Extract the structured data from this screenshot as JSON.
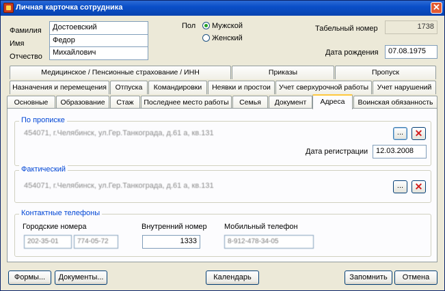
{
  "window": {
    "title": "Личная карточка сотрудника",
    "close_glyph": "✕"
  },
  "personal": {
    "surname_label": "Фамилия",
    "surname": "Достоевский",
    "name_label": "Имя",
    "name": "Федор",
    "patronymic_label": "Отчество",
    "patronymic": "Михайлович",
    "gender_label": "Пол",
    "male": "Мужской",
    "female": "Женский",
    "gender_selected": "male",
    "tab_number_label": "Табельный номер",
    "tab_number": "1738",
    "birth_label": "Дата рождения",
    "birth": "07.08.1975"
  },
  "tabs_row1": [
    {
      "label": "Медицинское / Пенсионные страхование / ИНН"
    },
    {
      "label": "Приказы"
    },
    {
      "label": "Пропуск"
    }
  ],
  "tabs_row2": [
    {
      "label": "Назначения и перемещения"
    },
    {
      "label": "Отпуска"
    },
    {
      "label": "Командировки"
    },
    {
      "label": "Неявки и простои"
    },
    {
      "label": "Учет сверхурочной работы"
    },
    {
      "label": "Учет нарушений"
    }
  ],
  "tabs_row3": [
    {
      "label": "Основные"
    },
    {
      "label": "Образование"
    },
    {
      "label": "Стаж"
    },
    {
      "label": "Последнее место работы"
    },
    {
      "label": "Семья"
    },
    {
      "label": "Документ"
    },
    {
      "label": "Адреса",
      "active": true
    },
    {
      "label": "Воинская обязанность"
    }
  ],
  "addresses": {
    "registration_title": "По прописке",
    "registration_address": "454071, г.Челябинск, ул.Гер.Танкограда, д.61 а, кв.131",
    "reg_date_label": "Дата регистрации",
    "reg_date": "12.03.2008",
    "actual_title": "Фактический",
    "actual_address": "454071, г.Челябинск, ул.Гер.Танкограда, д.61 а, кв.131",
    "browse_glyph": "...",
    "delete_glyph": "✕"
  },
  "phones": {
    "title": "Контактные телефоны",
    "city_label": "Городские номера",
    "city1": "202-35-01",
    "city2": "774-05-72",
    "internal_label": "Внутренний номер",
    "internal": "1333",
    "mobile_label": "Мобильный телефон",
    "mobile": "8-912-478-34-05"
  },
  "buttons": {
    "forms": "Формы...",
    "documents": "Документы...",
    "calendar": "Календарь",
    "save": "Запомнить",
    "cancel": "Отмена"
  }
}
